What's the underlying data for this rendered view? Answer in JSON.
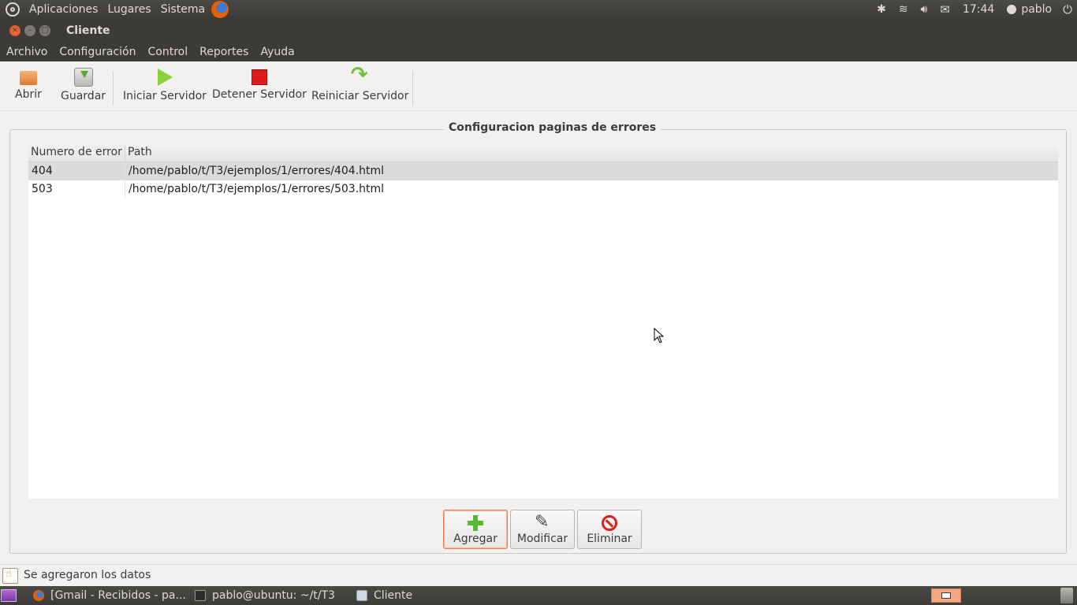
{
  "top_panel": {
    "menus": [
      "Aplicaciones",
      "Lugares",
      "Sistema"
    ],
    "clock": "17:44",
    "user": "pablo"
  },
  "window": {
    "title": "Cliente",
    "menus": [
      "Archivo",
      "Configuración",
      "Control",
      "Reportes",
      "Ayuda"
    ]
  },
  "toolbar": {
    "open": "Abrir",
    "save": "Guardar",
    "start_server": "Iniciar Servidor",
    "stop_server": "Detener Servidor",
    "restart_server": "Reiniciar Servidor"
  },
  "error_pages": {
    "frame_title": "Configuracion paginas de errores",
    "columns": [
      "Numero de error",
      "Path"
    ],
    "rows": [
      {
        "code": "404",
        "path": "/home/pablo/t/T3/ejemplos/1/errores/404.html"
      },
      {
        "code": "503",
        "path": "/home/pablo/t/T3/ejemplos/1/errores/503.html"
      }
    ],
    "selected_row": 0
  },
  "actions": {
    "add": "Agregar",
    "modify": "Modificar",
    "delete": "Eliminar"
  },
  "status": {
    "text": "Se agregaron los datos"
  },
  "taskbar": {
    "tasks": [
      "[Gmail - Recibidos - pa...",
      "pablo@ubuntu: ~/t/T3",
      "Cliente"
    ]
  },
  "icons": {
    "open": "folder-open-icon",
    "save": "save-icon",
    "start": "play-icon",
    "stop": "stop-icon",
    "restart": "redo-icon",
    "add": "plus-icon",
    "modify": "pencil-icon",
    "delete": "no-entry-icon"
  },
  "colors": {
    "accent": "#f07746",
    "panel": "#3c3b37",
    "selection": "#dcdbd9"
  }
}
